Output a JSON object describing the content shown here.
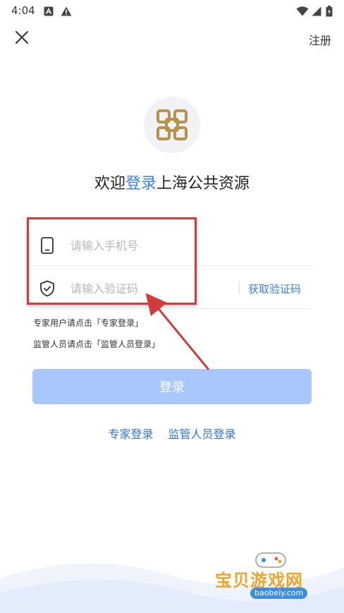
{
  "status_bar": {
    "time": "4:04"
  },
  "header": {
    "register_label": "注册"
  },
  "welcome": {
    "prefix": "欢迎",
    "accent": "登录",
    "suffix": "上海公共资源"
  },
  "form": {
    "phone_placeholder": "请输入手机号",
    "phone_value": "",
    "code_placeholder": "请输入验证码",
    "code_value": "",
    "get_code_label": "获取验证码"
  },
  "hints": {
    "expert": "专家用户请点击「专家登录」",
    "supervisor": "监管人员请点击「监管人员登录」"
  },
  "login_button_label": "登录",
  "links": {
    "expert_login": "专家登录",
    "supervisor_login": "监管人员登录"
  },
  "watermark": {
    "title": "宝贝游戏网",
    "url": "baobeiy.com"
  },
  "colors": {
    "accent": "#3b7ff0",
    "login_button": "#a8c7fb",
    "annotation": "#d43b3b",
    "logo_gold": "#b8924a"
  }
}
